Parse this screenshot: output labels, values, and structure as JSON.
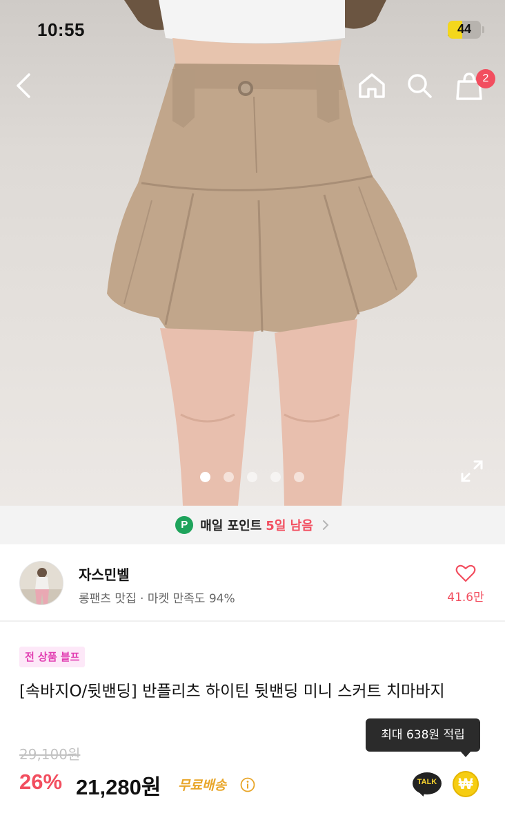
{
  "status_bar": {
    "time": "10:55",
    "battery": "44",
    "battery_level": 0.44
  },
  "header": {
    "cart_count": "2"
  },
  "gallery": {
    "image_count": 5,
    "active_index": 0
  },
  "point_banner": {
    "icon_letter": "P",
    "text": "매일 포인트",
    "days_left": "5일 남음"
  },
  "shop": {
    "name": "자스민벨",
    "description": "롱팬츠 맛집 · 마켓 만족도 94%",
    "likes": "41.6만"
  },
  "product": {
    "badge": "전 상품 블프",
    "title": "[속바지O/뒷밴딩] 반플리츠 하이틴 뒷밴딩 미니 스커트 치마바지",
    "original_price": "29,100원",
    "discount": "26%",
    "price": "21,280원",
    "shipping": "무료배송"
  },
  "reward": {
    "tooltip": "최대 638원 적립",
    "talk_label": "TALK",
    "won_symbol": "₩"
  },
  "colors": {
    "accent": "#f24e5f",
    "point_green": "#1ea35b",
    "shipping": "#e8a528",
    "badge_bg": "#fde8f8",
    "badge_text": "#e23fb2"
  }
}
